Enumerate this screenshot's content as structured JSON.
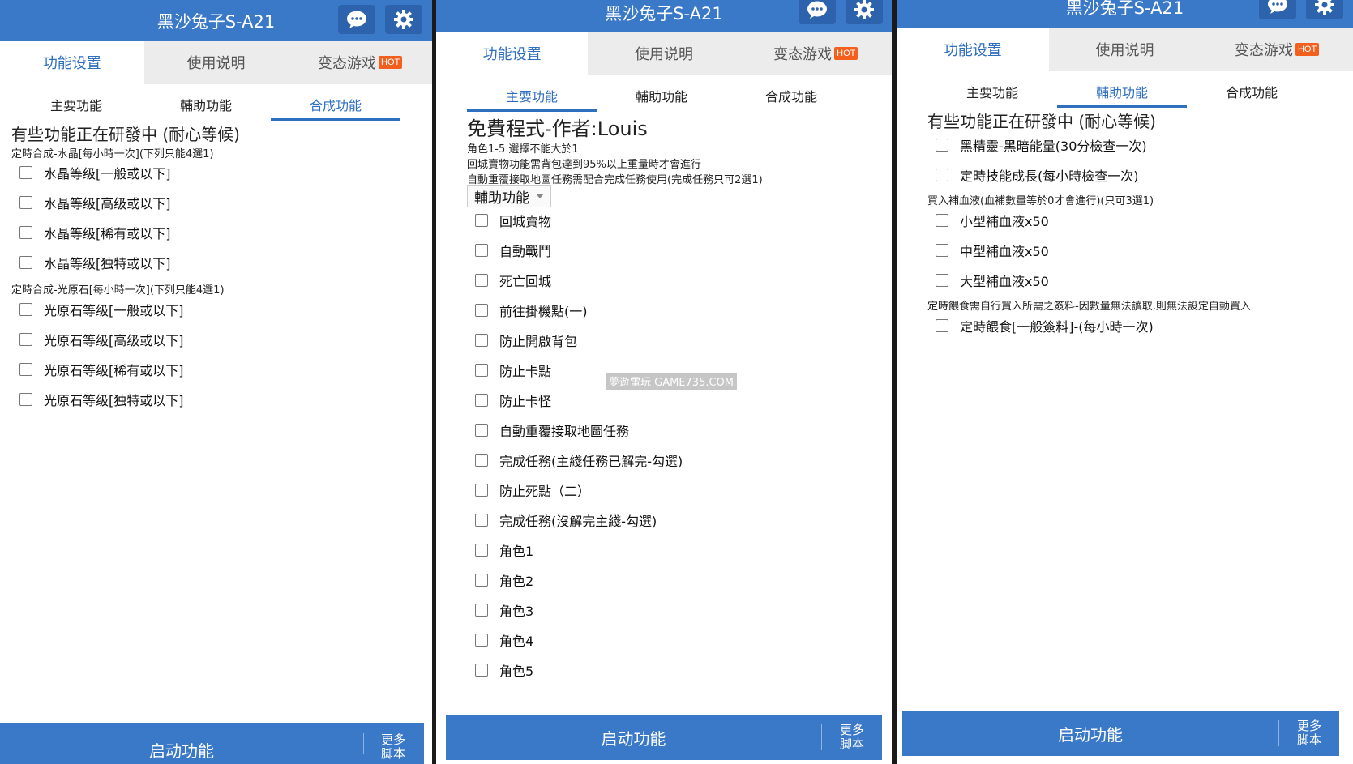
{
  "app_title": "黑沙兔子S-A21",
  "tabs": {
    "settings": "功能设置",
    "manual": "使用说明",
    "games": "变态游戏",
    "hot_badge": "HOT"
  },
  "subtabs": {
    "main": "主要功能",
    "assist": "輔助功能",
    "synth": "合成功能"
  },
  "footer": {
    "start": "启动功能",
    "more_line1": "更多",
    "more_line2": "脚本"
  },
  "panel1": {
    "heading": "有些功能正在研發中 (耐心等候)",
    "section1": "定時合成-水晶[每小時一次](下列只能4選1)",
    "crystal_items": [
      "水晶等级[一般或以下]",
      "水晶等级[高级或以下]",
      "水晶等级[稀有或以下]",
      "水晶等级[独特或以下]"
    ],
    "section2": "定時合成-光原石[每小時一次](下列只能4選1)",
    "ore_items": [
      "光原石等级[一般或以下]",
      "光原石等级[高级或以下]",
      "光原石等级[稀有或以下]",
      "光原石等级[独特或以下]"
    ]
  },
  "panel2": {
    "heading": "免費程式-作者:Louis",
    "notes": [
      "角色1-5 選擇不能大於1",
      "回城賣物功能需背包達到95%以上重量時才會進行",
      "自動重覆接取地圖任務需配合完成任務使用(完成任務只可2選1)"
    ],
    "select_value": "輔助功能",
    "items": [
      "回城賣物",
      "自動戰鬥",
      "死亡回城",
      "前往掛機點(一)",
      "防止開啟背包",
      "防止卡點",
      "防止卡怪",
      "自動重覆接取地圖任務",
      "完成任務(主綫任務已解完-勾選)",
      "防止死點（二）",
      "完成任務(沒解完主綫-勾選)",
      "角色1",
      "角色2",
      "角色3",
      "角色4",
      "角色5"
    ],
    "watermark": "夢遊電玩 GAME735.COM"
  },
  "panel3": {
    "heading": "有些功能正在研發中 (耐心等候)",
    "items_top": [
      "黑精靈-黑暗能量(30分檢查一次)",
      "定時技能成長(每小時檢查一次)"
    ],
    "section1": "買入補血液(血補數量等於0才會進行)(只可3選1)",
    "potion_items": [
      "小型補血液x50",
      "中型補血液x50",
      "大型補血液x50"
    ],
    "section2": "定時餵食需自行買入所需之簽料-因數量無法讀取,則無法設定自動買入",
    "feed_items": [
      "定時餵食[一般簽料]-(每小時一次)"
    ]
  },
  "colors": {
    "primary": "#3a78c8",
    "primary_dark": "#2d63ac",
    "accent_text": "#2f6fc0",
    "hot": "#f35f1d"
  }
}
